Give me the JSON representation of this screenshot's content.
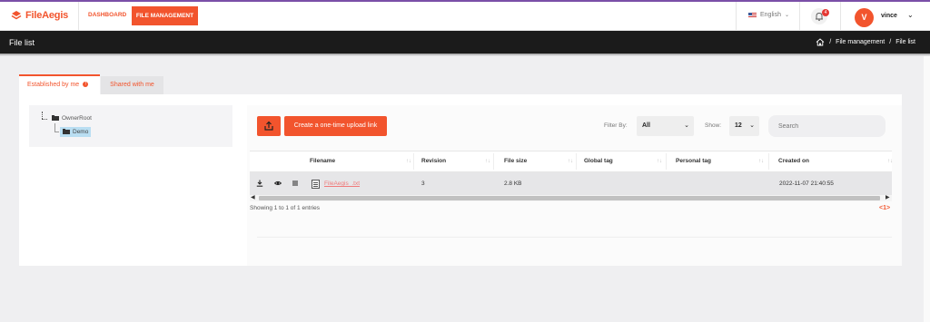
{
  "app": {
    "logo_text": "FileAegis"
  },
  "nav": {
    "dashboard": "DASHBOARD",
    "file_management": "FILE MANAGEMENT"
  },
  "header": {
    "language": "English",
    "notifications_count": "4",
    "avatar_initial": "V",
    "username": "vince"
  },
  "titlebar": {
    "title": "File list",
    "breadcrumb": [
      "/",
      "File management",
      "/",
      "File list"
    ]
  },
  "tabs": {
    "established": "Established by me",
    "established_badge": "!",
    "shared": "Shared with me"
  },
  "tree": {
    "root": "OwnerRoot",
    "child": "Demo"
  },
  "toolbar": {
    "create_link_label": "Create a one-time upload link",
    "filter_label": "Filter By:",
    "filter_value": "All",
    "show_label": "Show:",
    "show_value": "12",
    "search_placeholder": "Search"
  },
  "table": {
    "columns": [
      "Filename",
      "Revision",
      "File size",
      "Global tag",
      "Personal tag",
      "Created on"
    ],
    "rows": [
      {
        "filename": "FileAegis_.txt",
        "revision": "3",
        "file_size": "2.8 KB",
        "global_tag": "",
        "personal_tag": "",
        "created_on": "2022-11-07 21:40:55"
      }
    ],
    "info": "Showing 1 to 1 of 1 entries",
    "pager": "<1>"
  },
  "colors": {
    "accent": "#f2542d",
    "titlebar": "#1b1b1b"
  }
}
